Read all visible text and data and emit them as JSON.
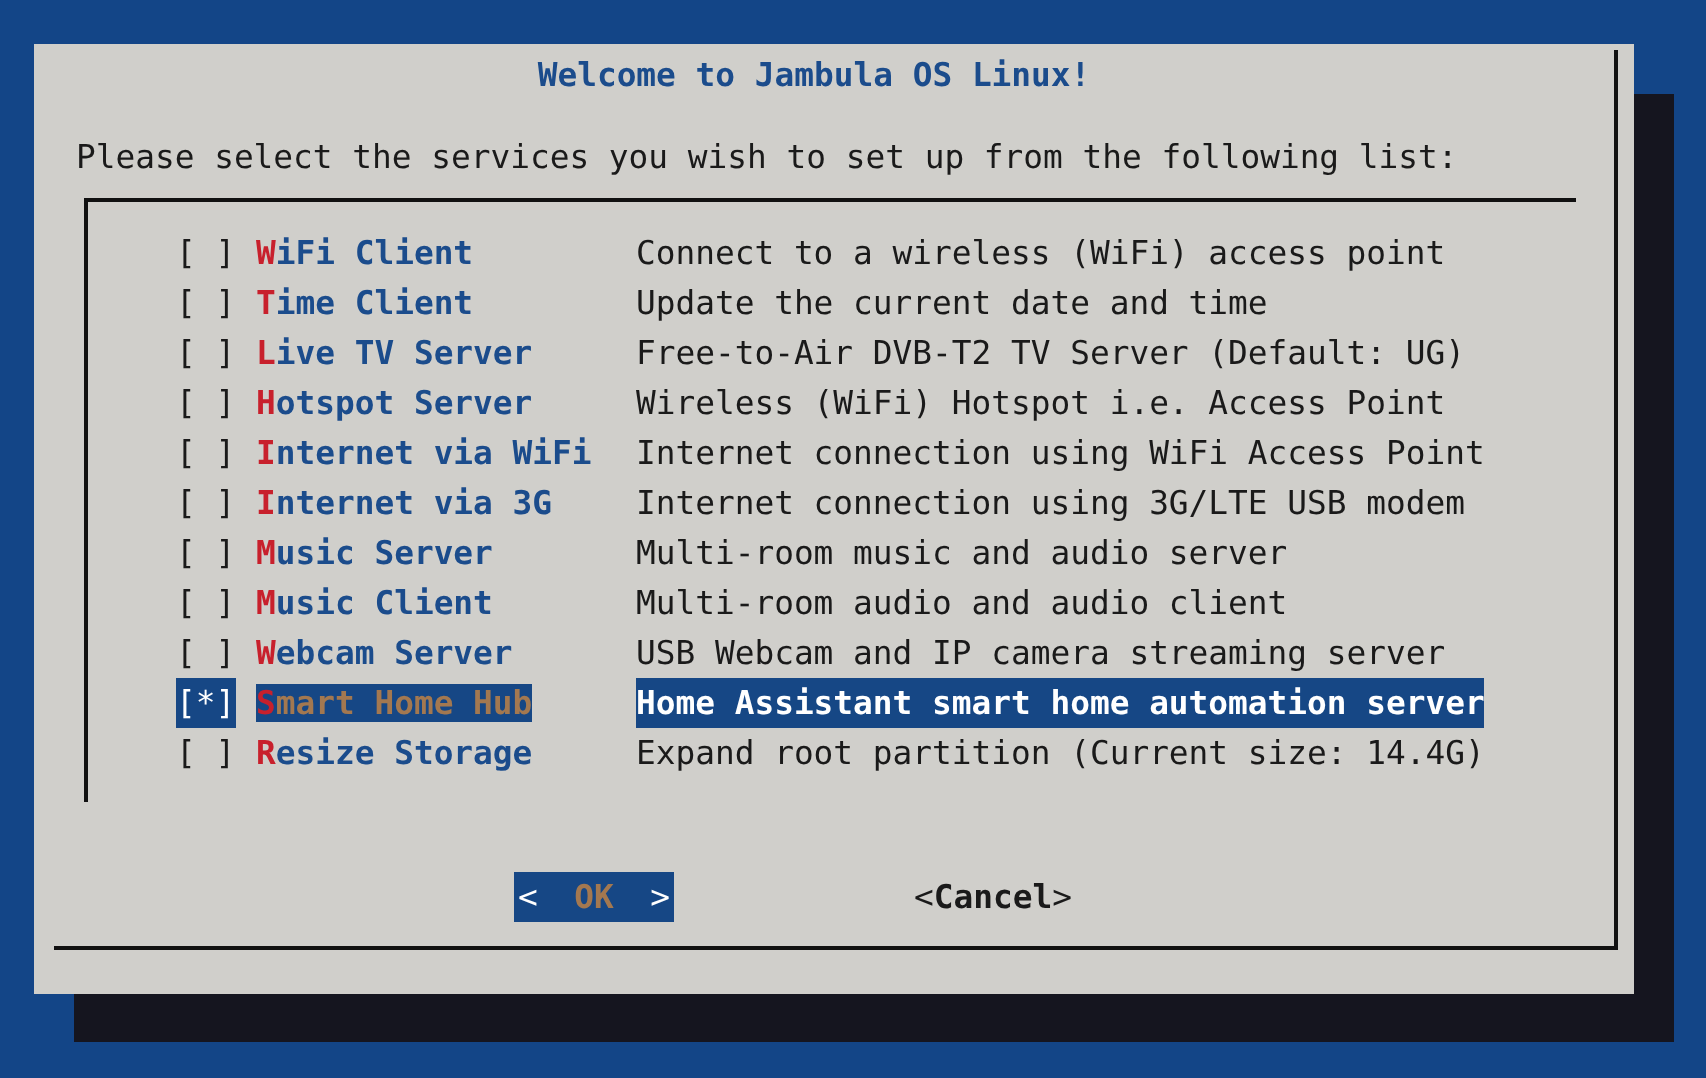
{
  "dialog": {
    "title": "Welcome to Jambula OS Linux!",
    "prompt": "Please select the services you wish to set up from the following list:",
    "items": [
      {
        "box": "[ ]",
        "label": "WiFi Client",
        "description": "Connect to a wireless (WiFi) access point",
        "selected": false
      },
      {
        "box": "[ ]",
        "label": "Time Client",
        "description": "Update the current date and time",
        "selected": false
      },
      {
        "box": "[ ]",
        "label": "Live TV Server",
        "description": "Free-to-Air DVB-T2 TV Server (Default: UG)",
        "selected": false
      },
      {
        "box": "[ ]",
        "label": "Hotspot Server",
        "description": "Wireless (WiFi) Hotspot i.e. Access Point",
        "selected": false
      },
      {
        "box": "[ ]",
        "label": "Internet via WiFi",
        "description": "Internet connection using WiFi Access Point",
        "selected": false
      },
      {
        "box": "[ ]",
        "label": "Internet via 3G",
        "description": "Internet connection using 3G/LTE USB modem",
        "selected": false
      },
      {
        "box": "[ ]",
        "label": "Music Server",
        "description": "Multi-room music and audio server",
        "selected": false
      },
      {
        "box": "[ ]",
        "label": "Music Client",
        "description": "Multi-room audio and audio client",
        "selected": false
      },
      {
        "box": "[ ]",
        "label": "Webcam Server",
        "description": "USB Webcam and IP camera streaming server",
        "selected": false
      },
      {
        "box": "[*]",
        "label": "Smart Home Hub",
        "description": "Home Assistant smart home automation server",
        "selected": true
      },
      {
        "box": "[ ]",
        "label": "Resize Storage",
        "description": "Expand root partition (Current size: 14.4G)",
        "selected": false
      }
    ],
    "buttons": [
      {
        "open": "<",
        "label": "OK",
        "close": ">",
        "selected": true
      },
      {
        "open": "<",
        "label": "Cancel",
        "close": ">",
        "selected": false
      }
    ]
  }
}
